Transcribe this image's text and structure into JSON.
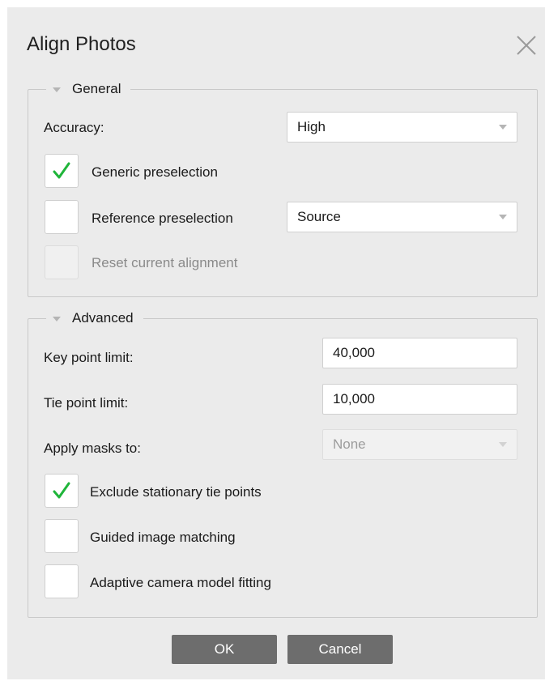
{
  "dialog": {
    "title": "Align Photos"
  },
  "general": {
    "legend": "General",
    "accuracy_label": "Accuracy:",
    "accuracy_value": "High",
    "generic_preselection": {
      "label": "Generic preselection",
      "checked": true
    },
    "reference_preselection": {
      "label": "Reference preselection",
      "checked": false,
      "value": "Source"
    },
    "reset_alignment": {
      "label": "Reset current alignment",
      "checked": false,
      "disabled": true
    }
  },
  "advanced": {
    "legend": "Advanced",
    "key_point_label": "Key point limit:",
    "key_point_value": "40,000",
    "tie_point_label": "Tie point limit:",
    "tie_point_value": "10,000",
    "apply_masks_label": "Apply masks to:",
    "apply_masks_value": "None",
    "exclude_stationary": {
      "label": "Exclude stationary tie points",
      "checked": true
    },
    "guided_matching": {
      "label": "Guided image matching",
      "checked": false
    },
    "adaptive_fitting": {
      "label": "Adaptive camera model fitting",
      "checked": false
    }
  },
  "buttons": {
    "ok": "OK",
    "cancel": "Cancel"
  },
  "colors": {
    "check_green": "#1fb53a",
    "dialog_bg": "#ebebeb",
    "button_bg": "#6d6d6d"
  }
}
